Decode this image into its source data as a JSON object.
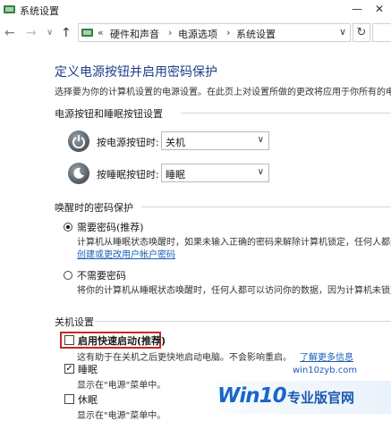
{
  "window": {
    "title": "系统设置",
    "minimize": "—",
    "close": "✕"
  },
  "nav": {
    "back": "←",
    "forward": "→",
    "down": "∨",
    "up": "↑",
    "overflow": "«",
    "crumbs": [
      "硬件和声音",
      "电源选项",
      "系统设置"
    ],
    "separator": "›",
    "dropdown": "∨",
    "refresh": "↻"
  },
  "heading": "定义电源按钮并启用密码保护",
  "description": "选择要为你的计算机设置的电源设置。在此页上对设置所做的更改将应用于你所有的电",
  "section_buttons": {
    "title": "电源按钮和睡眠按钮设置",
    "power_label": "按电源按钮时:",
    "power_value": "关机",
    "sleep_label": "按睡眠按钮时:",
    "sleep_value": "睡眠"
  },
  "section_password": {
    "title": "唤醒时的密码保护",
    "require_label": "需要密码(推荐)",
    "require_desc": "计算机从睡眠状态唤醒时，如果未输入正确的密码来解除计算机锁定，任何人都无",
    "require_link": "创建或更改用户帐户密码",
    "norequire_label": "不需要密码",
    "norequire_desc": "将你的计算机从睡眠状态唤醒时，任何人都可以访问你的数据，因为计算机未锁定"
  },
  "section_shutdown": {
    "title": "关机设置",
    "fast_label": "启用快速启动(推荐)",
    "fast_checked": false,
    "fast_desc": "这有助于在关机之后更快地启动电脑。不会影响重启。",
    "fast_link": "了解更多信息",
    "sleep_label": "睡眠",
    "sleep_checked": true,
    "sleep_desc": "显示在\"电源\"菜单中。",
    "hibernate_label": "休眠",
    "hibernate_checked": false,
    "hibernate_desc": "显示在\"电源\"菜单中。"
  },
  "watermark": {
    "logo": "Win10",
    "text": "专业版官网",
    "url": "win10zyb.com"
  },
  "colors": {
    "heading": "#1e3f87",
    "link": "#1a5fb4",
    "highlight": "#c62828"
  }
}
